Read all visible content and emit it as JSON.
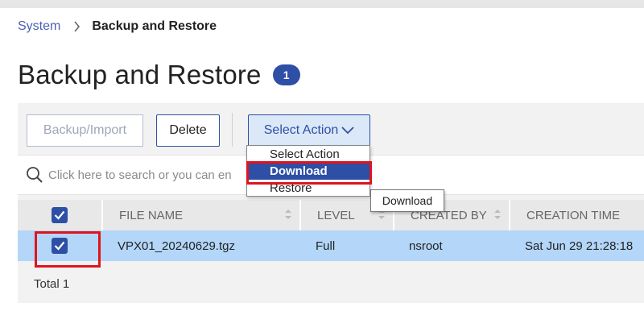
{
  "breadcrumb": {
    "root": "System",
    "current": "Backup and Restore"
  },
  "page": {
    "title": "Backup and Restore",
    "count": "1"
  },
  "toolbar": {
    "backup_label": "Backup/Import",
    "delete_label": "Delete",
    "select_action_label": "Select Action"
  },
  "search": {
    "placeholder": "Click here to search or you can en"
  },
  "table": {
    "headers": [
      "FILE NAME",
      "LEVEL",
      "CREATED BY",
      "CREATION TIME"
    ],
    "rows": [
      {
        "file_name": "VPX01_20240629.tgz",
        "level": "Full",
        "created_by": "nsroot",
        "creation_time": "Sat Jun 29 21:28:18"
      }
    ],
    "total": "Total 1"
  },
  "dropdown": {
    "items": [
      "Select Action",
      "Download",
      "Restore"
    ],
    "selected_index": 1
  },
  "tooltip": {
    "text": "Download"
  },
  "colors": {
    "accent": "#2e4fa6",
    "selected_row": "#b3d6f9",
    "highlight": "#e0141e"
  },
  "icons": {
    "breadcrumb_separator": "chevron-right-icon",
    "search": "search-icon",
    "sort": "sort-icon",
    "dropdown": "chevron-down-icon",
    "checkbox": "checkmark-icon"
  }
}
